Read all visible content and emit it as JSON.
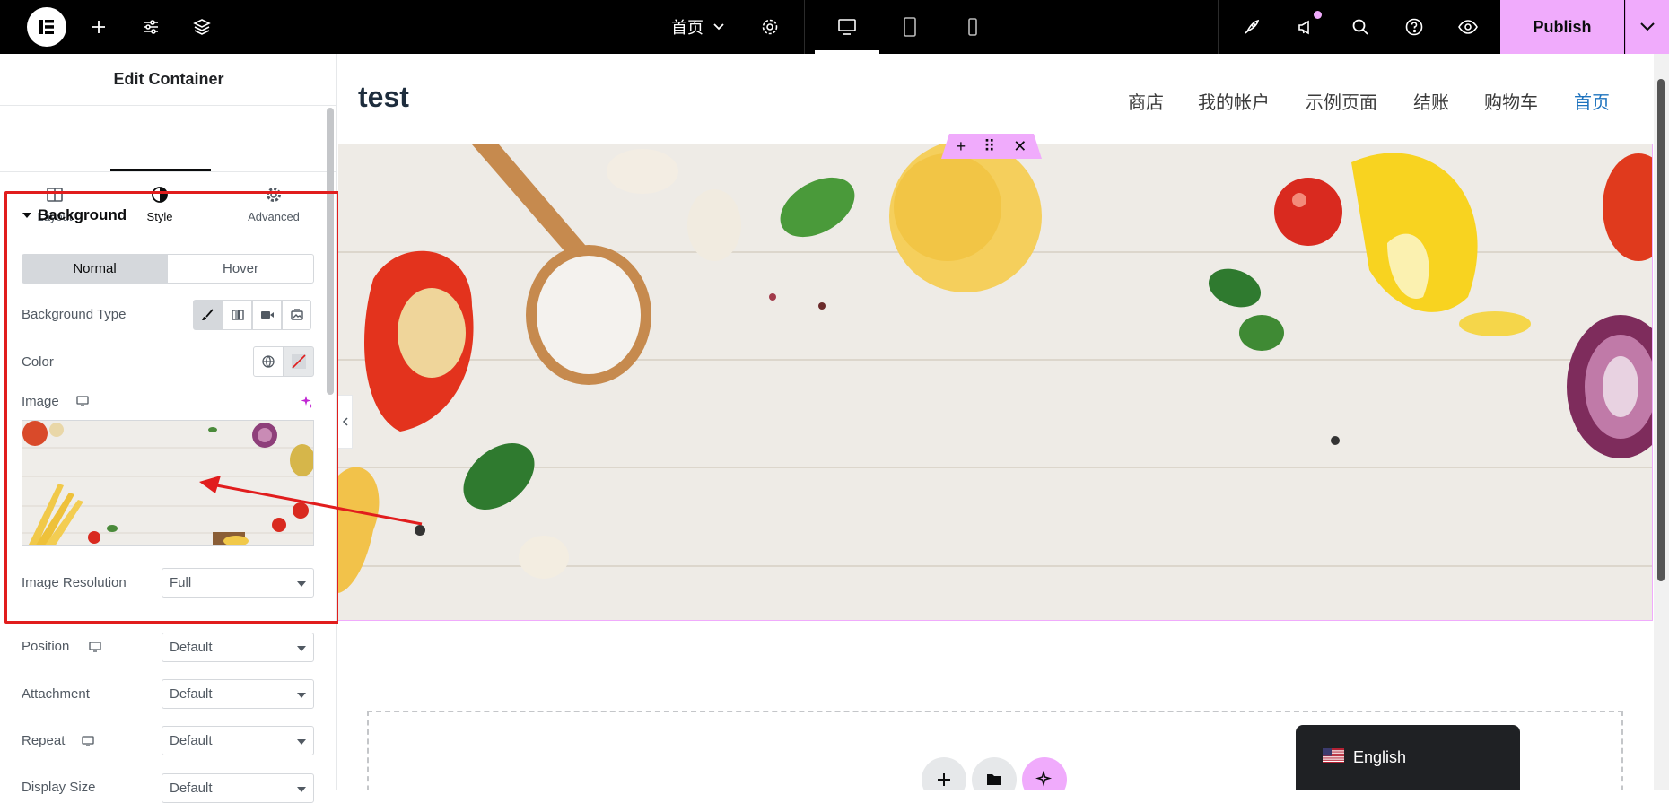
{
  "topbar": {
    "page_name": "首页",
    "publish_label": "Publish",
    "icons": [
      "elementor-logo-icon",
      "plus-icon",
      "sliders-icon",
      "layers-icon",
      "page-settings-icon",
      "desktop-icon",
      "tablet-icon",
      "mobile-icon",
      "rocket-icon",
      "megaphone-icon",
      "search-icon",
      "help-icon",
      "eye-icon",
      "chevron-down-icon"
    ]
  },
  "panel": {
    "title": "Edit Container",
    "tabs": [
      {
        "label": "Layout",
        "icon": "layout-icon"
      },
      {
        "label": "Style",
        "icon": "half-circle-icon"
      },
      {
        "label": "Advanced",
        "icon": "gear-icon"
      }
    ],
    "section_title": "Background",
    "state_tabs": [
      "Normal",
      "Hover"
    ],
    "background_type_label": "Background Type",
    "color_label": "Color",
    "image_label": "Image",
    "image_resolution_label": "Image Resolution",
    "image_resolution_value": "Full",
    "position_label": "Position",
    "position_value": "Default",
    "attachment_label": "Attachment",
    "attachment_value": "Default",
    "repeat_label": "Repeat",
    "repeat_value": "Default",
    "display_size_label": "Display Size",
    "display_size_value": "Default"
  },
  "site": {
    "title": "test",
    "nav": [
      "商店",
      "我的帐户",
      "示例页面",
      "结账",
      "购物车",
      "首页"
    ],
    "active_nav_color": "#1e73be"
  },
  "language_switcher": {
    "label": "English"
  },
  "colors": {
    "accent": "#f0abfc",
    "highlight": "#e11d1d"
  }
}
